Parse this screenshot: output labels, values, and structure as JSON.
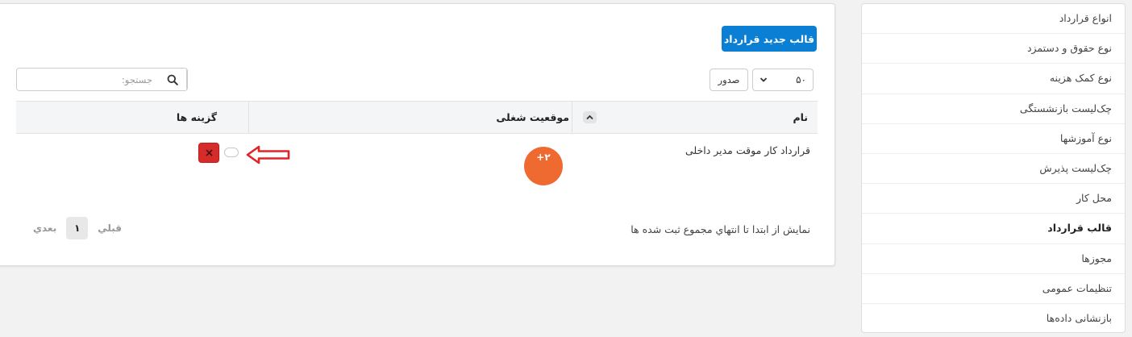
{
  "sidebar": {
    "items": [
      {
        "label": "انواع قرارداد"
      },
      {
        "label": "نوع حقوق و دستمزد"
      },
      {
        "label": "نوع کمک هزینه"
      },
      {
        "label": "چک‌لیست بازنشستگی"
      },
      {
        "label": "نوع آموزشها"
      },
      {
        "label": "چک‌لیست پذیرش"
      },
      {
        "label": "محل کار"
      },
      {
        "label": "قالب قرارداد"
      },
      {
        "label": "مجوزها"
      },
      {
        "label": "تنظیمات عمومی"
      },
      {
        "label": "بازنشانی داده‌ها"
      }
    ],
    "active_index": 7
  },
  "toolbar": {
    "new_button": "قالب جدید قرارداد",
    "search_placeholder": "جستجو:",
    "export_button": "صدور",
    "page_size": "۵۰"
  },
  "table": {
    "columns": [
      "نام",
      "موقعیت شغلی",
      "گزینه ها"
    ],
    "rows": [
      {
        "name": "قرارداد کار موقت مدیر داخلی",
        "position_badge": "+۲"
      }
    ]
  },
  "footer": {
    "info": "نمایش از ابتدا تا انتهاي مجموع ثبت شده ها",
    "prev": "قبلي",
    "current_page": "۱",
    "next": "بعدي"
  },
  "colors": {
    "primary": "#0b7fd3",
    "badge": "#ef6a30",
    "danger": "#d62b2b",
    "arrow": "#e0242a"
  }
}
